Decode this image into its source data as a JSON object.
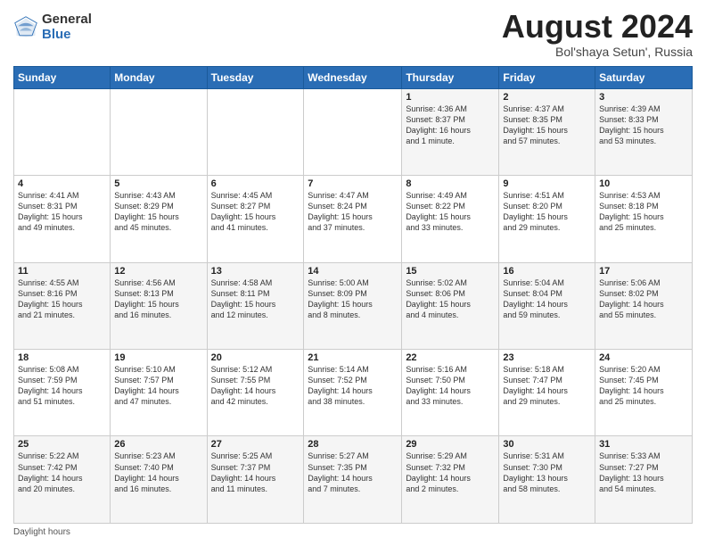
{
  "header": {
    "logo_general": "General",
    "logo_blue": "Blue",
    "month_title": "August 2024",
    "location": "Bol'shaya Setun', Russia"
  },
  "footer": {
    "daylight_label": "Daylight hours"
  },
  "weekdays": [
    "Sunday",
    "Monday",
    "Tuesday",
    "Wednesday",
    "Thursday",
    "Friday",
    "Saturday"
  ],
  "weeks": [
    [
      {
        "day": "",
        "info": ""
      },
      {
        "day": "",
        "info": ""
      },
      {
        "day": "",
        "info": ""
      },
      {
        "day": "",
        "info": ""
      },
      {
        "day": "1",
        "info": "Sunrise: 4:36 AM\nSunset: 8:37 PM\nDaylight: 16 hours\nand 1 minute."
      },
      {
        "day": "2",
        "info": "Sunrise: 4:37 AM\nSunset: 8:35 PM\nDaylight: 15 hours\nand 57 minutes."
      },
      {
        "day": "3",
        "info": "Sunrise: 4:39 AM\nSunset: 8:33 PM\nDaylight: 15 hours\nand 53 minutes."
      }
    ],
    [
      {
        "day": "4",
        "info": "Sunrise: 4:41 AM\nSunset: 8:31 PM\nDaylight: 15 hours\nand 49 minutes."
      },
      {
        "day": "5",
        "info": "Sunrise: 4:43 AM\nSunset: 8:29 PM\nDaylight: 15 hours\nand 45 minutes."
      },
      {
        "day": "6",
        "info": "Sunrise: 4:45 AM\nSunset: 8:27 PM\nDaylight: 15 hours\nand 41 minutes."
      },
      {
        "day": "7",
        "info": "Sunrise: 4:47 AM\nSunset: 8:24 PM\nDaylight: 15 hours\nand 37 minutes."
      },
      {
        "day": "8",
        "info": "Sunrise: 4:49 AM\nSunset: 8:22 PM\nDaylight: 15 hours\nand 33 minutes."
      },
      {
        "day": "9",
        "info": "Sunrise: 4:51 AM\nSunset: 8:20 PM\nDaylight: 15 hours\nand 29 minutes."
      },
      {
        "day": "10",
        "info": "Sunrise: 4:53 AM\nSunset: 8:18 PM\nDaylight: 15 hours\nand 25 minutes."
      }
    ],
    [
      {
        "day": "11",
        "info": "Sunrise: 4:55 AM\nSunset: 8:16 PM\nDaylight: 15 hours\nand 21 minutes."
      },
      {
        "day": "12",
        "info": "Sunrise: 4:56 AM\nSunset: 8:13 PM\nDaylight: 15 hours\nand 16 minutes."
      },
      {
        "day": "13",
        "info": "Sunrise: 4:58 AM\nSunset: 8:11 PM\nDaylight: 15 hours\nand 12 minutes."
      },
      {
        "day": "14",
        "info": "Sunrise: 5:00 AM\nSunset: 8:09 PM\nDaylight: 15 hours\nand 8 minutes."
      },
      {
        "day": "15",
        "info": "Sunrise: 5:02 AM\nSunset: 8:06 PM\nDaylight: 15 hours\nand 4 minutes."
      },
      {
        "day": "16",
        "info": "Sunrise: 5:04 AM\nSunset: 8:04 PM\nDaylight: 14 hours\nand 59 minutes."
      },
      {
        "day": "17",
        "info": "Sunrise: 5:06 AM\nSunset: 8:02 PM\nDaylight: 14 hours\nand 55 minutes."
      }
    ],
    [
      {
        "day": "18",
        "info": "Sunrise: 5:08 AM\nSunset: 7:59 PM\nDaylight: 14 hours\nand 51 minutes."
      },
      {
        "day": "19",
        "info": "Sunrise: 5:10 AM\nSunset: 7:57 PM\nDaylight: 14 hours\nand 47 minutes."
      },
      {
        "day": "20",
        "info": "Sunrise: 5:12 AM\nSunset: 7:55 PM\nDaylight: 14 hours\nand 42 minutes."
      },
      {
        "day": "21",
        "info": "Sunrise: 5:14 AM\nSunset: 7:52 PM\nDaylight: 14 hours\nand 38 minutes."
      },
      {
        "day": "22",
        "info": "Sunrise: 5:16 AM\nSunset: 7:50 PM\nDaylight: 14 hours\nand 33 minutes."
      },
      {
        "day": "23",
        "info": "Sunrise: 5:18 AM\nSunset: 7:47 PM\nDaylight: 14 hours\nand 29 minutes."
      },
      {
        "day": "24",
        "info": "Sunrise: 5:20 AM\nSunset: 7:45 PM\nDaylight: 14 hours\nand 25 minutes."
      }
    ],
    [
      {
        "day": "25",
        "info": "Sunrise: 5:22 AM\nSunset: 7:42 PM\nDaylight: 14 hours\nand 20 minutes."
      },
      {
        "day": "26",
        "info": "Sunrise: 5:23 AM\nSunset: 7:40 PM\nDaylight: 14 hours\nand 16 minutes."
      },
      {
        "day": "27",
        "info": "Sunrise: 5:25 AM\nSunset: 7:37 PM\nDaylight: 14 hours\nand 11 minutes."
      },
      {
        "day": "28",
        "info": "Sunrise: 5:27 AM\nSunset: 7:35 PM\nDaylight: 14 hours\nand 7 minutes."
      },
      {
        "day": "29",
        "info": "Sunrise: 5:29 AM\nSunset: 7:32 PM\nDaylight: 14 hours\nand 2 minutes."
      },
      {
        "day": "30",
        "info": "Sunrise: 5:31 AM\nSunset: 7:30 PM\nDaylight: 13 hours\nand 58 minutes."
      },
      {
        "day": "31",
        "info": "Sunrise: 5:33 AM\nSunset: 7:27 PM\nDaylight: 13 hours\nand 54 minutes."
      }
    ]
  ]
}
